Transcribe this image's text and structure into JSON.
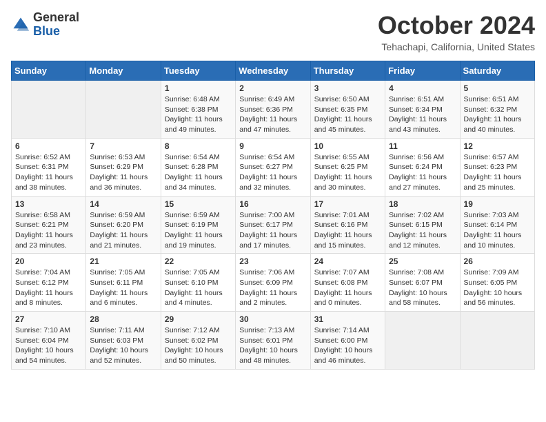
{
  "header": {
    "logo": {
      "general": "General",
      "blue": "Blue"
    },
    "title": "October 2024",
    "location": "Tehachapi, California, United States"
  },
  "weekdays": [
    "Sunday",
    "Monday",
    "Tuesday",
    "Wednesday",
    "Thursday",
    "Friday",
    "Saturday"
  ],
  "weeks": [
    [
      {
        "day": "",
        "empty": true
      },
      {
        "day": "",
        "empty": true
      },
      {
        "day": "1",
        "sunrise": "6:48 AM",
        "sunset": "6:38 PM",
        "daylight": "11 hours and 49 minutes."
      },
      {
        "day": "2",
        "sunrise": "6:49 AM",
        "sunset": "6:36 PM",
        "daylight": "11 hours and 47 minutes."
      },
      {
        "day": "3",
        "sunrise": "6:50 AM",
        "sunset": "6:35 PM",
        "daylight": "11 hours and 45 minutes."
      },
      {
        "day": "4",
        "sunrise": "6:51 AM",
        "sunset": "6:34 PM",
        "daylight": "11 hours and 43 minutes."
      },
      {
        "day": "5",
        "sunrise": "6:51 AM",
        "sunset": "6:32 PM",
        "daylight": "11 hours and 40 minutes."
      }
    ],
    [
      {
        "day": "6",
        "sunrise": "6:52 AM",
        "sunset": "6:31 PM",
        "daylight": "11 hours and 38 minutes."
      },
      {
        "day": "7",
        "sunrise": "6:53 AM",
        "sunset": "6:29 PM",
        "daylight": "11 hours and 36 minutes."
      },
      {
        "day": "8",
        "sunrise": "6:54 AM",
        "sunset": "6:28 PM",
        "daylight": "11 hours and 34 minutes."
      },
      {
        "day": "9",
        "sunrise": "6:54 AM",
        "sunset": "6:27 PM",
        "daylight": "11 hours and 32 minutes."
      },
      {
        "day": "10",
        "sunrise": "6:55 AM",
        "sunset": "6:25 PM",
        "daylight": "11 hours and 30 minutes."
      },
      {
        "day": "11",
        "sunrise": "6:56 AM",
        "sunset": "6:24 PM",
        "daylight": "11 hours and 27 minutes."
      },
      {
        "day": "12",
        "sunrise": "6:57 AM",
        "sunset": "6:23 PM",
        "daylight": "11 hours and 25 minutes."
      }
    ],
    [
      {
        "day": "13",
        "sunrise": "6:58 AM",
        "sunset": "6:21 PM",
        "daylight": "11 hours and 23 minutes."
      },
      {
        "day": "14",
        "sunrise": "6:59 AM",
        "sunset": "6:20 PM",
        "daylight": "11 hours and 21 minutes."
      },
      {
        "day": "15",
        "sunrise": "6:59 AM",
        "sunset": "6:19 PM",
        "daylight": "11 hours and 19 minutes."
      },
      {
        "day": "16",
        "sunrise": "7:00 AM",
        "sunset": "6:17 PM",
        "daylight": "11 hours and 17 minutes."
      },
      {
        "day": "17",
        "sunrise": "7:01 AM",
        "sunset": "6:16 PM",
        "daylight": "11 hours and 15 minutes."
      },
      {
        "day": "18",
        "sunrise": "7:02 AM",
        "sunset": "6:15 PM",
        "daylight": "11 hours and 12 minutes."
      },
      {
        "day": "19",
        "sunrise": "7:03 AM",
        "sunset": "6:14 PM",
        "daylight": "11 hours and 10 minutes."
      }
    ],
    [
      {
        "day": "20",
        "sunrise": "7:04 AM",
        "sunset": "6:12 PM",
        "daylight": "11 hours and 8 minutes."
      },
      {
        "day": "21",
        "sunrise": "7:05 AM",
        "sunset": "6:11 PM",
        "daylight": "11 hours and 6 minutes."
      },
      {
        "day": "22",
        "sunrise": "7:05 AM",
        "sunset": "6:10 PM",
        "daylight": "11 hours and 4 minutes."
      },
      {
        "day": "23",
        "sunrise": "7:06 AM",
        "sunset": "6:09 PM",
        "daylight": "11 hours and 2 minutes."
      },
      {
        "day": "24",
        "sunrise": "7:07 AM",
        "sunset": "6:08 PM",
        "daylight": "11 hours and 0 minutes."
      },
      {
        "day": "25",
        "sunrise": "7:08 AM",
        "sunset": "6:07 PM",
        "daylight": "10 hours and 58 minutes."
      },
      {
        "day": "26",
        "sunrise": "7:09 AM",
        "sunset": "6:05 PM",
        "daylight": "10 hours and 56 minutes."
      }
    ],
    [
      {
        "day": "27",
        "sunrise": "7:10 AM",
        "sunset": "6:04 PM",
        "daylight": "10 hours and 54 minutes."
      },
      {
        "day": "28",
        "sunrise": "7:11 AM",
        "sunset": "6:03 PM",
        "daylight": "10 hours and 52 minutes."
      },
      {
        "day": "29",
        "sunrise": "7:12 AM",
        "sunset": "6:02 PM",
        "daylight": "10 hours and 50 minutes."
      },
      {
        "day": "30",
        "sunrise": "7:13 AM",
        "sunset": "6:01 PM",
        "daylight": "10 hours and 48 minutes."
      },
      {
        "day": "31",
        "sunrise": "7:14 AM",
        "sunset": "6:00 PM",
        "daylight": "10 hours and 46 minutes."
      },
      {
        "day": "",
        "empty": true
      },
      {
        "day": "",
        "empty": true
      }
    ]
  ],
  "labels": {
    "sunrise_prefix": "Sunrise: ",
    "sunset_prefix": "Sunset: ",
    "daylight_prefix": "Daylight: "
  }
}
